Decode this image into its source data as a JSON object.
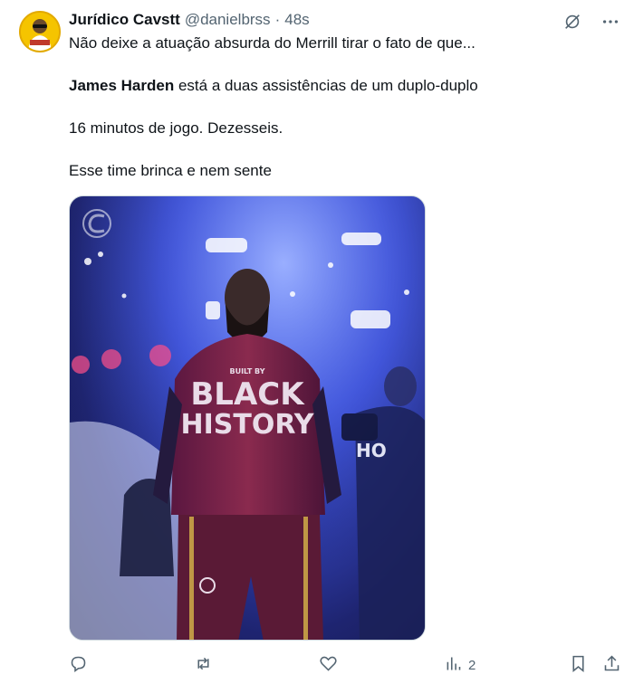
{
  "author": {
    "display_name": "Jurídico Cavstt",
    "handle": "@danielbrss",
    "separator": "·",
    "time": "48s"
  },
  "tweet": {
    "line1": "Não deixe a atuação absurda do Merrill tirar o fato de que...",
    "line2_bold": "James Harden",
    "line2_rest": " está a duas assistências de um duplo-duplo",
    "line3": "16 minutos de jogo. Dezesseis.",
    "line4": "Esse time brinca e nem sente"
  },
  "media": {
    "shirt_text_small": "BUILT BY",
    "shirt_text_line1": "BLACK",
    "shirt_text_line2": "HISTORY",
    "fan_shirt_text": "HO"
  },
  "metrics": {
    "views": "2"
  },
  "icons": {
    "grok": "grok-icon",
    "more": "more-icon",
    "reply": "reply-icon",
    "retweet": "retweet-icon",
    "like": "like-icon",
    "views": "views-icon",
    "bookmark": "bookmark-icon",
    "share": "share-icon"
  },
  "colors": {
    "text": "#0f1419",
    "secondary": "#536471",
    "media_blue": "#3b4fd6",
    "shirt": "#7a1f3a"
  }
}
